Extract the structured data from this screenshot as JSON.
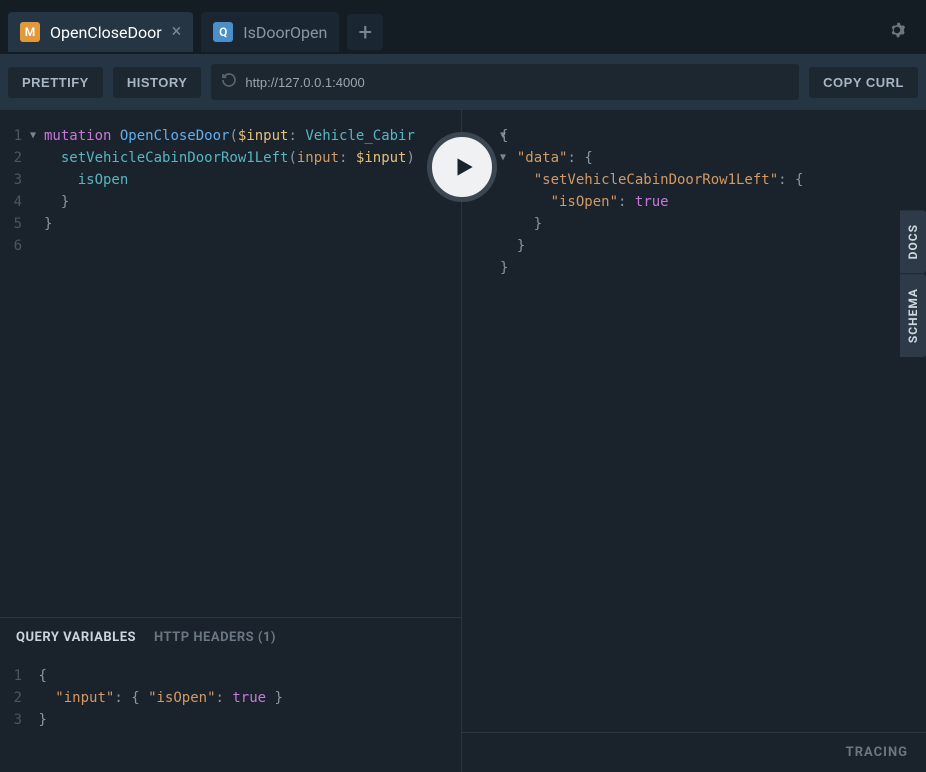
{
  "tabs": [
    {
      "badge": "M",
      "badgeType": "mutation",
      "label": "OpenCloseDoor",
      "active": true
    },
    {
      "badge": "Q",
      "badgeType": "query",
      "label": "IsDoorOpen",
      "active": false
    }
  ],
  "toolbar": {
    "prettify": "PRETTIFY",
    "history": "HISTORY",
    "url": "http://127.0.0.1:4000",
    "copycurl": "COPY CURL"
  },
  "query": {
    "lines": [
      1,
      2,
      3,
      4,
      5,
      6
    ],
    "tokens": {
      "kw_mutation": "mutation",
      "op_name": "OpenCloseDoor",
      "var_input": "$input",
      "type_vehicle": "Vehicle_Cabir",
      "field_set": "setVehicleCabinDoorRow1Left",
      "arg_input": "input",
      "field_isopen": "isOpen"
    }
  },
  "bottom": {
    "tab_vars": "QUERY VARIABLES",
    "tab_headers": "HTTP HEADERS (1)"
  },
  "vars": {
    "lines": [
      1,
      2,
      3
    ],
    "key_input": "\"input\"",
    "key_isopen": "\"isOpen\"",
    "val_true": "true"
  },
  "result": {
    "key_data": "\"data\"",
    "key_set": "\"setVehicleCabinDoorRow1Left\"",
    "key_isopen": "\"isOpen\"",
    "val_true": "true"
  },
  "side": {
    "docs": "DOCS",
    "schema": "SCHEMA"
  },
  "tracing": "TRACING"
}
